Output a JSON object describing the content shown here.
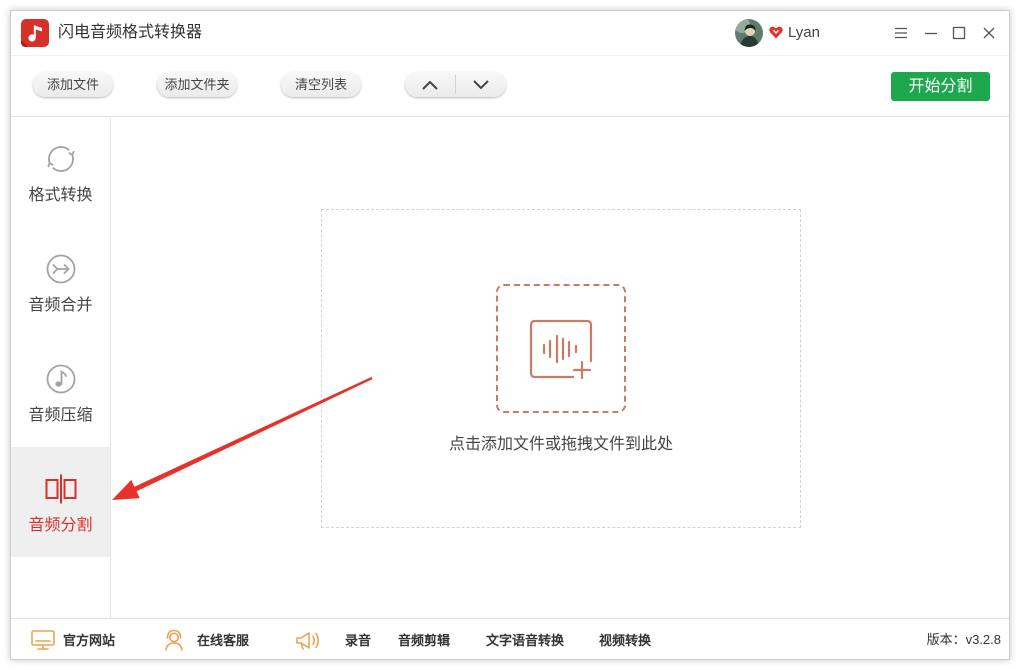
{
  "app": {
    "title": "闪电音频格式转换器",
    "icon": "music-note-app-icon"
  },
  "user": {
    "name": "Lyan",
    "avatar": "user-avatar",
    "badge_icon": "vip-heart-icon"
  },
  "window_controls": [
    {
      "icon": "menu-icon"
    },
    {
      "icon": "minimize-icon"
    },
    {
      "icon": "maximize-icon"
    },
    {
      "icon": "close-icon"
    }
  ],
  "toolbar": {
    "add_file": "添加文件",
    "add_folder": "添加文件夹",
    "clear_list": "清空列表",
    "move_up_icon": "chevron-up-icon",
    "move_down_icon": "chevron-down-icon",
    "start": "开始分割"
  },
  "sidebar": {
    "items": [
      {
        "label": "格式转换",
        "icon": "refresh-icon",
        "active": false
      },
      {
        "label": "音频合并",
        "icon": "merge-icon",
        "active": false
      },
      {
        "label": "音频压缩",
        "icon": "music-note-icon",
        "active": false
      },
      {
        "label": "音频分割",
        "icon": "split-icon",
        "active": true
      }
    ]
  },
  "dropzone": {
    "icon": "add-audio-icon",
    "hint": "点击添加文件或拖拽文件到此处"
  },
  "footer": {
    "links": [
      {
        "label": "官方网站",
        "icon": "monitor-icon"
      },
      {
        "label": "在线客服",
        "icon": "customer-service-icon"
      },
      {
        "label": "录音",
        "icon": "megaphone-icon"
      },
      {
        "label": "音频剪辑"
      },
      {
        "label": "文字语音转换"
      },
      {
        "label": "视频转换"
      }
    ],
    "version": "版本：v3.2.8"
  },
  "colors": {
    "accent_red": "#d8312b",
    "start_button_green": "#1ea84d",
    "dropzone_icon": "#c97b63",
    "footer_icon": "#eba350",
    "annotation_arrow": "#e8312a"
  }
}
